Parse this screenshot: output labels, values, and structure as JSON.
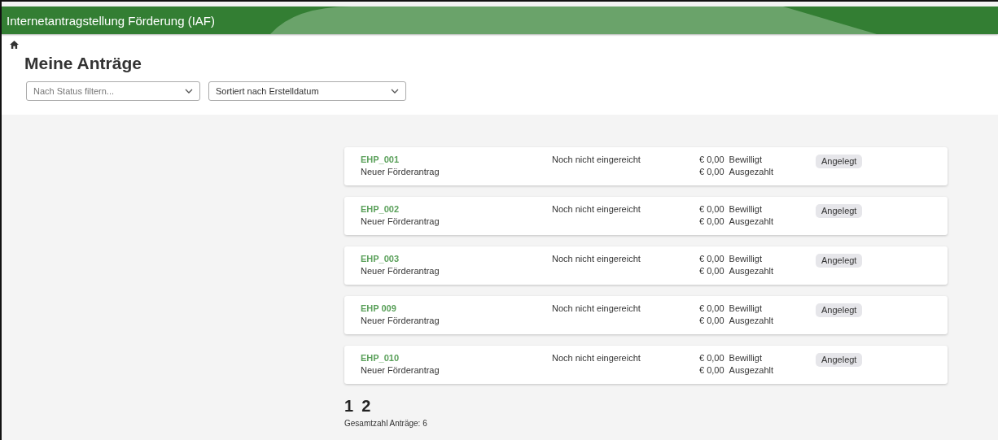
{
  "header": {
    "title": "Internetantragstellung Förderung (IAF)"
  },
  "page": {
    "title": "Meine Anträge"
  },
  "filters": {
    "status": {
      "placeholder": "Nach Status filtern..."
    },
    "sort": {
      "value": "Sortiert nach Erstelldatum"
    }
  },
  "applications": [
    {
      "id": "EHP_001",
      "name": "Neuer Förderantrag",
      "submission": "Noch nicht eingereicht",
      "approved_amount": "€ 0,00",
      "approved_label": "Bewilligt",
      "paid_amount": "€ 0,00",
      "paid_label": "Ausgezahlt",
      "status": "Angelegt"
    },
    {
      "id": "EHP_002",
      "name": "Neuer Förderantrag",
      "submission": "Noch nicht eingereicht",
      "approved_amount": "€ 0,00",
      "approved_label": "Bewilligt",
      "paid_amount": "€ 0,00",
      "paid_label": "Ausgezahlt",
      "status": "Angelegt"
    },
    {
      "id": "EHP_003",
      "name": "Neuer Förderantrag",
      "submission": "Noch nicht eingereicht",
      "approved_amount": "€ 0,00",
      "approved_label": "Bewilligt",
      "paid_amount": "€ 0,00",
      "paid_label": "Ausgezahlt",
      "status": "Angelegt"
    },
    {
      "id": "EHP 009",
      "name": "Neuer Förderantrag",
      "submission": "Noch nicht eingereicht",
      "approved_amount": "€ 0,00",
      "approved_label": "Bewilligt",
      "paid_amount": "€ 0,00",
      "paid_label": "Ausgezahlt",
      "status": "Angelegt"
    },
    {
      "id": "EHP_010",
      "name": "Neuer Förderantrag",
      "submission": "Noch nicht eingereicht",
      "approved_amount": "€ 0,00",
      "approved_label": "Bewilligt",
      "paid_amount": "€ 0,00",
      "paid_label": "Ausgezahlt",
      "status": "Angelegt"
    }
  ],
  "pagination": {
    "pages": [
      "1",
      "2"
    ],
    "total": "Gesamtzahl Anträge: 6"
  }
}
